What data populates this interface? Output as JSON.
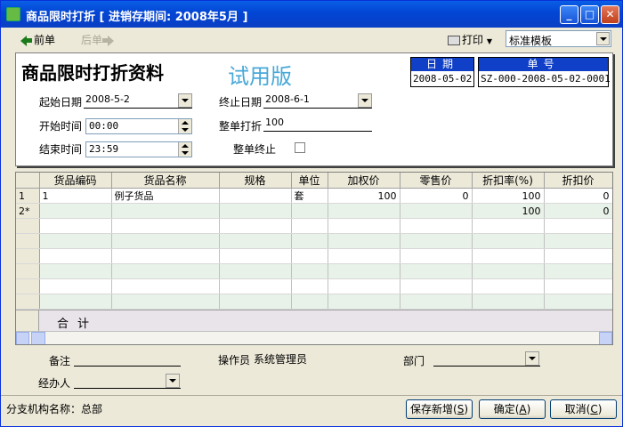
{
  "window": {
    "title": "商品限时打折 [ 进销存期间: 2008年5月 ]",
    "min_label": "_",
    "max_label": "□",
    "close_label": "✕"
  },
  "toolbar": {
    "prev_label": "前单",
    "next_label": "后单",
    "print_label": "打印",
    "template_value": "标准模板"
  },
  "form": {
    "title": "商品限时打折资料",
    "trial_label": "试用版",
    "date_header": "日期",
    "date_value": "2008-05-02",
    "number_header": "单号",
    "number_value": "SZ-000-2008-05-02-0001",
    "start_date_label": "起始日期",
    "start_date_value": "2008-5-2",
    "end_date_label": "终止日期",
    "end_date_value": "2008-6-1",
    "start_time_label": "开始时间",
    "start_time_value": "00:00",
    "whole_discount_label": "整单打折",
    "whole_discount_value": "100",
    "end_time_label": "结束时间",
    "end_time_value": "23:59",
    "whole_stop_label": "整单终止"
  },
  "grid": {
    "columns": [
      "货品编码",
      "货品名称",
      "规格",
      "单位",
      "加权价",
      "零售价",
      "折扣率(%)",
      "折扣价"
    ],
    "rows": [
      {
        "rh": "1",
        "code": "1",
        "name": "例子货品",
        "spec": "",
        "unit": "套",
        "weighted": "100",
        "retail": "0",
        "rate": "100",
        "price": "0"
      },
      {
        "rh": "2*",
        "code": "",
        "name": "",
        "spec": "",
        "unit": "",
        "weighted": "",
        "retail": "",
        "rate": "100",
        "price": "0"
      }
    ],
    "total_label": "合计"
  },
  "footer": {
    "remark_label": "备注",
    "operator_label": "操作员",
    "operator_value": "系统管理员",
    "dept_label": "部门",
    "handler_label": "经办人",
    "branch_label": "分支机构名称：",
    "branch_value": "总部"
  },
  "buttons": {
    "save_new": "保存新增",
    "save_new_key": "S",
    "ok": "确定",
    "ok_key": "A",
    "cancel": "取消",
    "cancel_key": "C"
  }
}
